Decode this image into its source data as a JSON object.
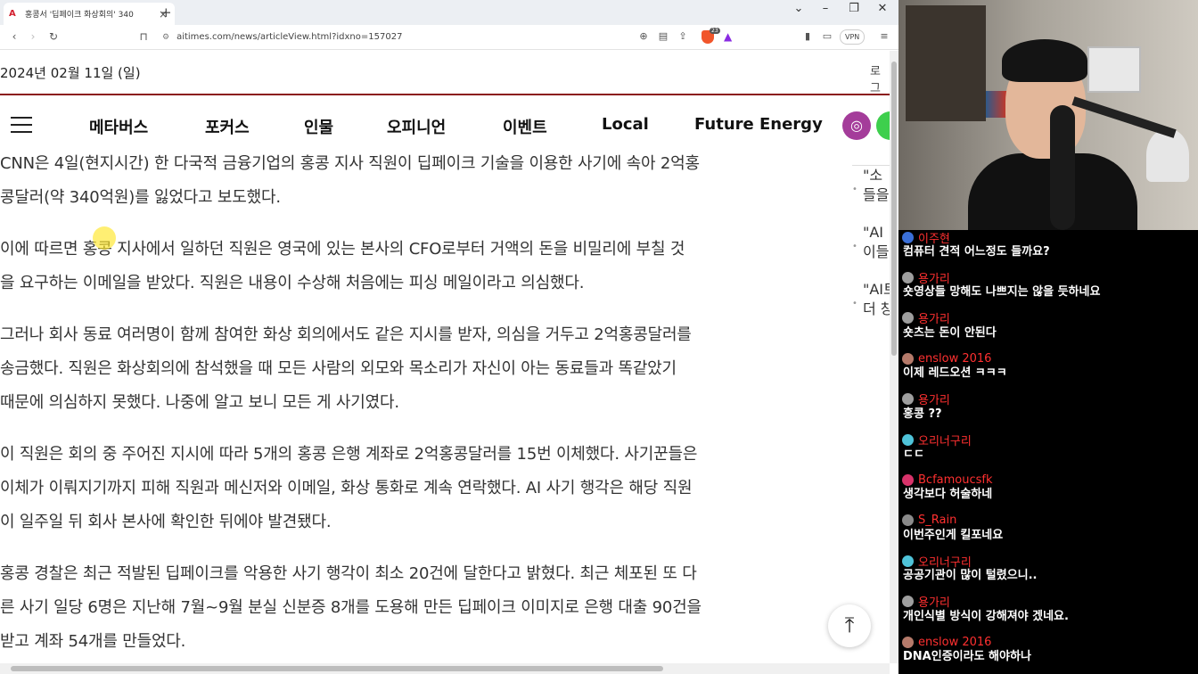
{
  "browser": {
    "tab_title": "홍콩서 '딥페이크 화상회의' 340",
    "tab_close": "×",
    "new_tab": "+",
    "url": "aitimes.com/news/articleView.html?idxno=157027",
    "brave_count": "23",
    "vpn_label": "VPN"
  },
  "header": {
    "date": "2024년 02월 11일 (일)",
    "login": "로그"
  },
  "menu": {
    "items": [
      "메타버스",
      "포커스",
      "인물",
      "오피니언",
      "이벤트",
      "Local",
      "Future Energy"
    ]
  },
  "article": {
    "paragraphs": [
      [
        "CNN은 4일(현지시간) 한 다국적 금융기업의 홍콩 지사 직원이 딥페이크 기술을 이용한 사기에 속아 2억홍",
        "콩달러(약 340억원)를 잃었다고 보도했다."
      ],
      [
        "이에 따르면 홍콩 지사에서 일하던 직원은 영국에 있는 본사의 CFO로부터 거액의 돈을 비밀리에 부칠 것",
        "을 요구하는 이메일을 받았다. 직원은 내용이 수상해 처음에는 피싱 메일이라고 의심했다."
      ],
      [
        "그러나 회사 동료 여러명이 함께 참여한 화상 회의에서도 같은 지시를 받자, 의심을 거두고 2억홍콩달러를",
        "송금했다. 직원은 화상회의에 참석했을 때 모든 사람의 외모와 목소리가 자신이 아는 동료들과 똑같았기",
        "때문에 의심하지 못했다. 나중에 알고 보니 모든 게 사기였다."
      ],
      [
        "이 직원은 회의 중 주어진 지시에 따라 5개의 홍콩 은행 계좌로 2억홍콩달러를 15번 이체했다. 사기꾼들은",
        "이체가 이뤄지기까지 피해 직원과 메신저와 이메일, 화상 통화로 계속 연락했다. AI 사기 행각은 해당 직원",
        "이 일주일 뒤 회사 본사에 확인한 뒤에야 발견됐다."
      ],
      [
        "홍콩 경찰은 최근 적발된 딥페이크를 악용한 사기 행각이 최소 20건에 달한다고 밝혔다. 최근 체포된 또 다",
        "른 사기 일당 6명은 지난해 7월~9월 분실 신분증 8개를 도용해 만든 딥페이크 이미지로 은행 대출 90건을",
        "받고 계좌 54개를 만들었다."
      ]
    ]
  },
  "related": {
    "items": [
      [
        "\"소",
        "들을"
      ],
      [
        "\"AI",
        "이들"
      ],
      [
        "\"AI트",
        "더 창"
      ]
    ]
  },
  "chat": {
    "messages": [
      {
        "name": "이주현",
        "text": "컴퓨터 견적 어느정도 들까요?",
        "avatar_color": "#3a6fd8"
      },
      {
        "name": "용가리",
        "text": "숏영상들 망해도 나쁘지는 않을 듯하네요",
        "avatar_color": "#9e9e9e"
      },
      {
        "name": "용가리",
        "text": "숏츠는 돈이 안된다",
        "avatar_color": "#9e9e9e"
      },
      {
        "name": "enslow 2016",
        "text": "이제 레드오션 ㅋㅋㅋ",
        "avatar_color": "#b57a6a"
      },
      {
        "name": "용가리",
        "text": "홍콩 ??",
        "avatar_color": "#9e9e9e"
      },
      {
        "name": "오리너구리",
        "text": "ㄷㄷ",
        "avatar_color": "#4fc3d9"
      },
      {
        "name": "Bcfamoucsfk",
        "text": "생각보다 허술하네",
        "avatar_color": "#d8336a"
      },
      {
        "name": "S_Rain",
        "text": "이번주인게 킬포네요",
        "avatar_color": "#8a8a8a"
      },
      {
        "name": "오리너구리",
        "text": "공공기관이 많이 털렸으니..",
        "avatar_color": "#4fc3d9"
      },
      {
        "name": "용가리",
        "text": "개인식별 방식이 강해져야 겠네요.",
        "avatar_color": "#9e9e9e"
      },
      {
        "name": "enslow 2016",
        "text": "DNA인증이라도 해야하나",
        "avatar_color": "#b57a6a"
      }
    ]
  }
}
